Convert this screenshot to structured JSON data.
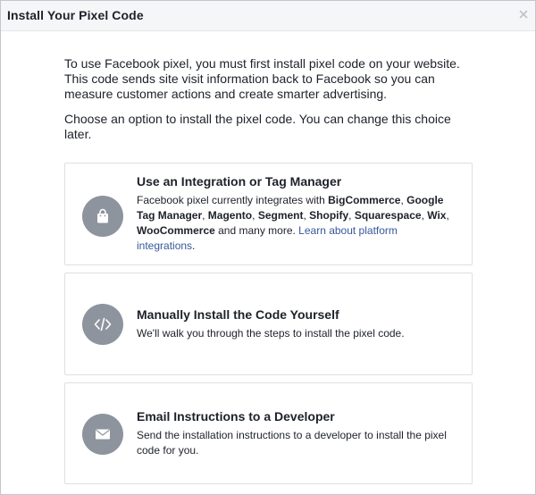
{
  "dialog": {
    "title": "Install Your Pixel Code",
    "close_glyph": "×"
  },
  "intro": {
    "paragraph1": "To use Facebook pixel, you must first install pixel code on your website. This code sends site visit information back to Facebook so you can measure customer actions and create smarter advertising.",
    "paragraph2": "Choose an option to install the pixel code. You can change this choice later."
  },
  "options": [
    {
      "title": "Use an Integration or Tag Manager",
      "icon": "shopping-bag-icon",
      "desc_prefix": "Facebook pixel currently integrates with ",
      "partners": [
        "BigCommerce",
        "Google Tag Manager",
        "Magento",
        "Segment",
        "Shopify",
        "Squarespace",
        "Wix",
        "WooCommerce"
      ],
      "separator": ", ",
      "desc_suffix": " and many more. ",
      "link_text": "Learn about platform integrations",
      "period": "."
    },
    {
      "title": "Manually Install the Code Yourself",
      "icon": "code-icon",
      "description": "We'll walk you through the steps to install the pixel code."
    },
    {
      "title": "Email Instructions to a Developer",
      "icon": "envelope-icon",
      "description": "Send the installation instructions to a developer to install the pixel code for you."
    }
  ],
  "colors": {
    "icon_circle": "#8d949e",
    "link": "#365899",
    "border": "#dddfe2",
    "header_bg": "#f5f6f7"
  }
}
